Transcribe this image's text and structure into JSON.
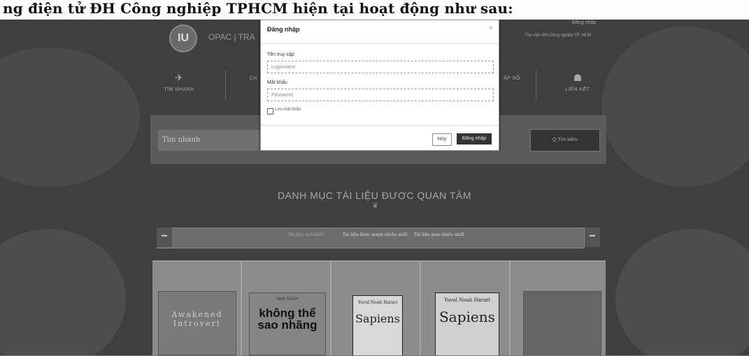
{
  "caption": "ng điện tử ĐH Công nghiệp TPHCM hiện tại hoạt động như sau:",
  "header": {
    "logo_text": "IU",
    "site_name": "OPAC | TRA",
    "right_text": "Thư viện ĐH Công nghiệp TP. HCM",
    "login_link": "Đăng nhập"
  },
  "nav": {
    "items": [
      {
        "label": "TÌM NHANH",
        "icon": "rocket-icon",
        "glyph": "✈"
      },
      {
        "label": "CH",
        "icon": "list-icon",
        "glyph": ""
      },
      {
        "label": "ẬP SỐ",
        "icon": "book-icon",
        "glyph": ""
      },
      {
        "label": "LIÊN KẾT",
        "icon": "sitemap-icon",
        "glyph": "☗"
      }
    ]
  },
  "search": {
    "placeholder": "Tìm nhanh",
    "button_label": "Q Tìm kiếm"
  },
  "catalog": {
    "title": "DANH MỤC TÀI LIỆU ĐƯỢC QUAN TÂM",
    "ornament": "❦",
    "tabs": [
      {
        "label": "Tài liệu mới nhất",
        "active": true
      },
      {
        "label": "Tài liệu được mượn nhiều nhất",
        "active": false
      },
      {
        "label": "Tài liệu xem nhiều nhất",
        "active": false
      }
    ],
    "prev_arrow": "−",
    "next_arrow": "−"
  },
  "books": [
    {
      "title": "Awakened Introvert",
      "subtitle": ""
    },
    {
      "title": "không thể sao nhãng",
      "subtitle": "NHÀ SÁCH"
    },
    {
      "title": "Sapiens",
      "subtitle": "Yuval Noah Harari"
    },
    {
      "title": "Sapiens",
      "subtitle": "Yuval Noah Harari"
    },
    {
      "title": "",
      "subtitle": ""
    }
  ],
  "modal": {
    "title": "Đăng nhập",
    "close": "×",
    "username_label": "Tên truy cập",
    "username_placeholder": "Loginname",
    "password_label": "Mật khẩu",
    "password_placeholder": "Password",
    "remember_label": "Lưu mật khẩu",
    "cancel_label": "Hủy",
    "login_label": "Đăng nhập"
  }
}
